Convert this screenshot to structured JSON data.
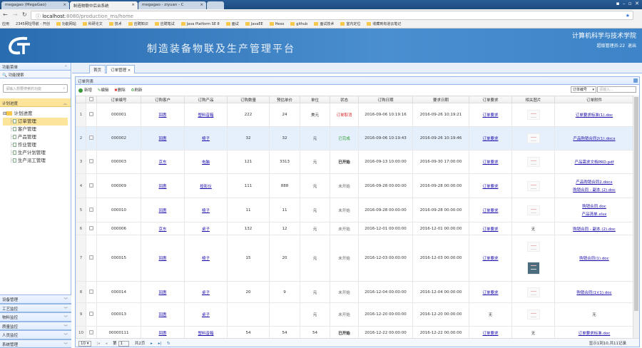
{
  "browser": {
    "tabs": [
      {
        "title": "megagao (MegaGao)"
      },
      {
        "title": "制造物联中后台系统",
        "active": true
      },
      {
        "title": "megagao - ziyuan - C"
      }
    ],
    "url_host": "localhost",
    "url_path": ":8080/production_ms/home",
    "bookmarks": [
      "应用",
      "2345网址导航 - 开创",
      "功能网站",
      "科研论文",
      "技术",
      "应聘知识",
      "应聘笔试",
      "Java Platform SE 8",
      "面试",
      "JavaEE",
      "Hexo",
      "github",
      "面试技术",
      "室内定位",
      "收藏到有道云笔记"
    ]
  },
  "header": {
    "title": "制造装备物联及生产管理平台",
    "college": "计算机科学与技术学院",
    "user": "超级管理员:22",
    "logout": "退出",
    "logo_text": "GT"
  },
  "sidebar": {
    "title": "功能菜单",
    "search_label": "功能搜索",
    "search_placeholder": "请输入想要搜索的功能",
    "active_section": "计划进度",
    "tree_root": "计划进度",
    "tree_items": [
      "订单管理",
      "客户管理",
      "产品管理",
      "作业管理",
      "生产计划管理",
      "生产派工管理"
    ],
    "selected_item": "订单管理",
    "sections": [
      "设备管理",
      "工艺监控",
      "物料监控",
      "质量监控",
      "人员监控",
      "系统管理"
    ]
  },
  "main": {
    "tabs": [
      {
        "label": "首页"
      },
      {
        "label": "订单管理",
        "closable": true
      }
    ],
    "panel_title": "订单列表",
    "toolbar": {
      "add": "新增",
      "edit": "编辑",
      "delete": "删除",
      "refresh": "刷新"
    },
    "search_field": "订单编号",
    "search_placeholder": "请输入...",
    "columns": [
      "订单编号",
      "订购客户",
      "订购产品",
      "订购数量",
      "预估单价",
      "单位",
      "状态",
      "订购日期",
      "要求日期",
      "订单要求",
      "相关图片",
      "订单附件"
    ],
    "rows": [
      {
        "n": "1",
        "id": "000001",
        "customer": "回惠",
        "product": "塑料音箱",
        "qty": "222",
        "price": "24",
        "unit": "美元",
        "status": "订单取消",
        "order_date": "2016-09-06 10:19:16",
        "req_date": "2016-09-26 10:19:21",
        "requirement": "订单要求",
        "images": 1,
        "attachments": [
          "订单要求标准(1).doc"
        ]
      },
      {
        "n": "2",
        "id": "000002",
        "customer": "回惠",
        "product": "椅子",
        "qty": "32",
        "price": "32",
        "unit": "元",
        "status": "已完成",
        "order_date": "2016-09-06 10:19:43",
        "req_date": "2016-09-26 10:19:46",
        "requirement": "订单要求",
        "images": 1,
        "attachments": [
          "产品购销合同2(1).docx"
        ]
      },
      {
        "n": "3",
        "id": "000003",
        "customer": "京东",
        "product": "电脑",
        "qty": "121",
        "price": "3313",
        "unit": "元",
        "status": "已开始",
        "order_date": "2016-09-13 10:00:00",
        "req_date": "2016-09-30 17:00:00",
        "requirement": "订单要求",
        "images": 1,
        "attachments": [
          "产品需求文档PRD.pdf"
        ]
      },
      {
        "n": "4",
        "id": "000009",
        "customer": "回惠",
        "product": "投影仪",
        "qty": "111",
        "price": "888",
        "unit": "元",
        "status": "未开始",
        "order_date": "2016-09-28 00:00:00",
        "req_date": "2016-09-28 00:00:00",
        "requirement": "订单要求",
        "images": 1,
        "attachments": [
          "产品购销合同2.docx",
          "购销合同 - 副本 (2).doc"
        ]
      },
      {
        "n": "5",
        "id": "000010",
        "customer": "回惠",
        "product": "椅子",
        "qty": "11",
        "price": "11",
        "unit": "元",
        "status": "未开始",
        "order_date": "2016-09-28 00:00:00",
        "req_date": "2016-09-28 00:00:00",
        "requirement": "订单要求",
        "images": 1,
        "attachments": [
          "购销合同.doc",
          "产品清单.xlsx"
        ]
      },
      {
        "n": "6",
        "id": "000006",
        "customer": "京东",
        "product": "桌子",
        "qty": "132",
        "price": "12",
        "unit": "元",
        "status": "未开始",
        "order_date": "2016-12-01 00:00:00",
        "req_date": "2016-12-01 00:00:00",
        "requirement": "订单要求",
        "images": 0,
        "no_image": "无",
        "attachments": [
          "购销合同 - 副本 (2).doc"
        ]
      },
      {
        "n": "7",
        "id": "000015",
        "customer": "回惠",
        "product": "椅子",
        "qty": "15",
        "price": "20",
        "unit": "元",
        "status": "未开始",
        "order_date": "2016-12-03 00:00:00",
        "req_date": "2016-12-03 00:00:00",
        "requirement": "订单要求",
        "images": 2,
        "attachments": [
          "购销合同(1).doc"
        ]
      },
      {
        "n": "8",
        "id": "000014",
        "customer": "回惠",
        "product": "桌子",
        "qty": "20",
        "price": "9",
        "unit": "元",
        "status": "未开始",
        "order_date": "2016-12-04 00:00:00",
        "req_date": "2016-12-04 00:00:00",
        "requirement": "订单要求",
        "images": 1,
        "attachments": [
          "购销合同(1)(1).doc"
        ]
      },
      {
        "n": "9",
        "id": "000013",
        "customer": "回惠",
        "product": "桌子",
        "qty": "",
        "price": "",
        "unit": "元",
        "status": "未开始",
        "order_date": "2016-12-20 00:00:00",
        "req_date": "2016-12-20 00:00:00",
        "requirement_none": "无",
        "images": 1,
        "attachments": [],
        "no_attachment": "无"
      },
      {
        "n": "10",
        "id": "00000111",
        "customer": "回惠",
        "product": "塑料音箱",
        "qty": "54",
        "price": "54",
        "unit": "54",
        "status": "已开始",
        "order_date": "2016-12-22 00:00:00",
        "req_date": "2016-12-22 00:00:00",
        "requirement": "订单要求",
        "images": 0,
        "no_image": "无",
        "attachments": [
          "订单要求标准.doc"
        ]
      }
    ],
    "status_colors": {
      "订单取消": "#d9262b",
      "已完成": "#2a9a2a",
      "已开始": "#222222",
      "未开始": "#666666"
    },
    "pager": {
      "page_size": "10",
      "page_label": "第",
      "page": "1",
      "total_pages": "共2页",
      "info": "显示1到10,共11记录"
    }
  }
}
